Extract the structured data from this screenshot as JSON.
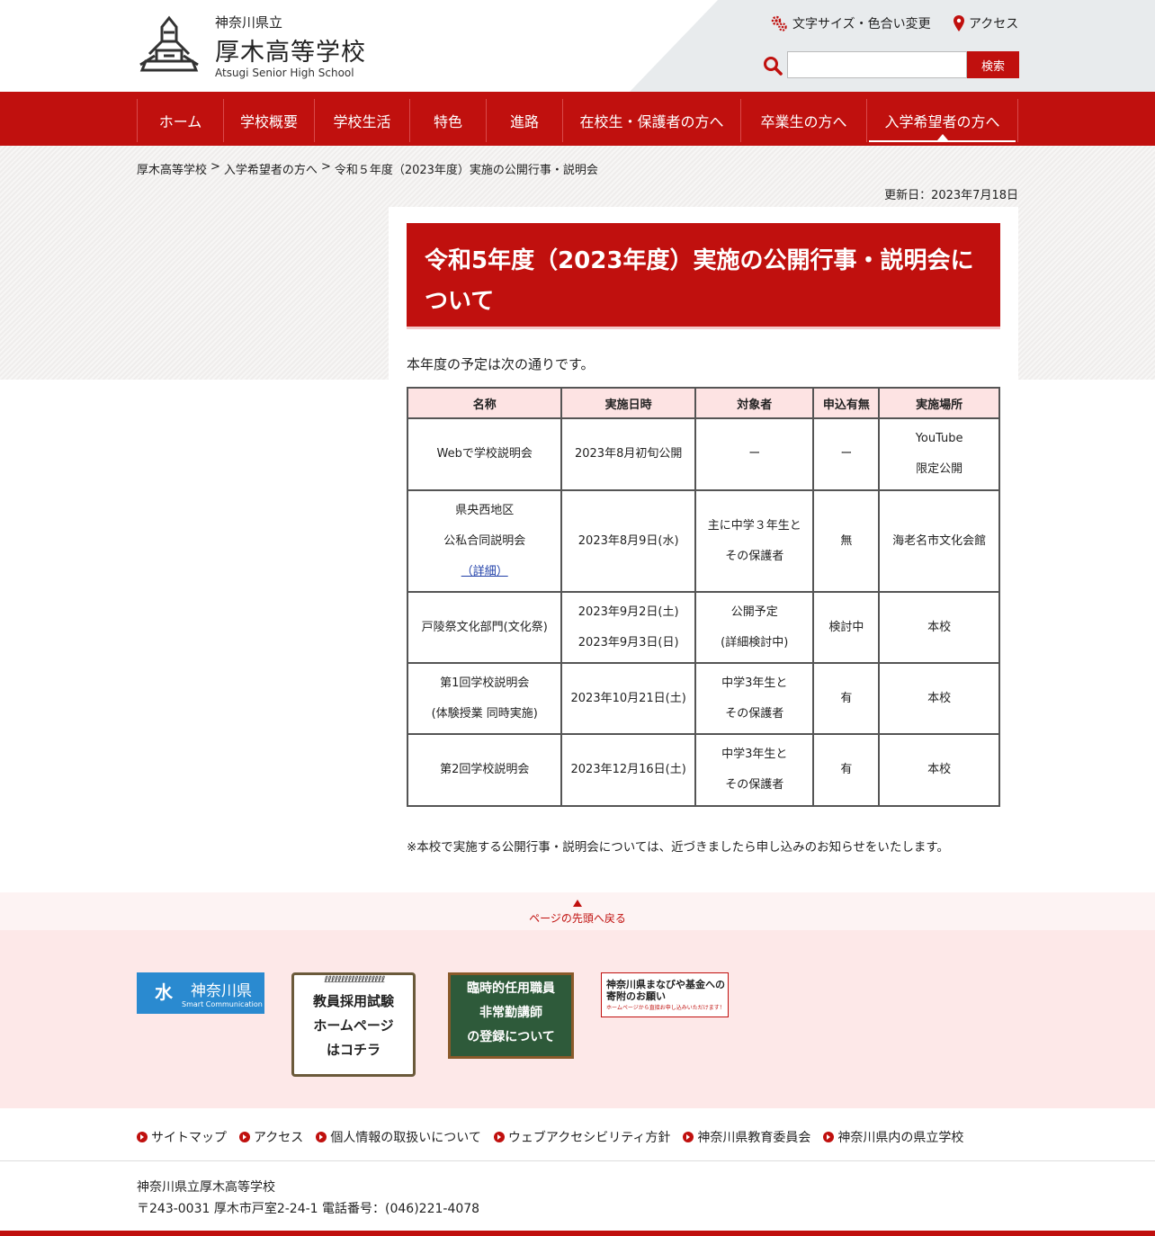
{
  "site": {
    "prefecture": "神奈川県立",
    "school_name": "厚木高等学校",
    "school_name_en": "Atsugi Senior High School",
    "brand_color": "#c0100e"
  },
  "utility": {
    "font_color_label": "文字サイズ・色合い変更",
    "access_label": "アクセス",
    "search_placeholder": "",
    "search_button": "検索"
  },
  "nav": {
    "items": [
      {
        "label": "ホーム"
      },
      {
        "label": "学校概要"
      },
      {
        "label": "学校生活"
      },
      {
        "label": "特色"
      },
      {
        "label": "進路"
      },
      {
        "label": "在校生・保護者の方へ"
      },
      {
        "label": "卒業生の方へ"
      },
      {
        "label": "入学希望者の方へ"
      }
    ]
  },
  "breadcrumb": {
    "items": [
      "厚木高等学校",
      "入学希望者の方へ",
      "令和５年度（2023年度）実施の公開行事・説明会"
    ],
    "separator": ">"
  },
  "updated": "更新日：2023年7月18日",
  "main": {
    "title": "令和5年度（2023年度）実施の公開行事・説明会について",
    "intro": "本年度の予定は次の通りです。",
    "table": {
      "headers": [
        "名称",
        "実施日時",
        "対象者",
        "申込有無",
        "実施場所"
      ],
      "rows": [
        {
          "name1": "Webで学校説明会",
          "name2": "",
          "name_link": "",
          "date1": "2023年8月初旬公開",
          "date2": "",
          "target1": "ー",
          "target2": "",
          "apply": "ー",
          "place1": "YouTube",
          "place2": "限定公開"
        },
        {
          "name1": "県央西地区",
          "name2": "公私合同説明会",
          "name_link": "（詳細）",
          "date1": "2023年8月9日(水)",
          "date2": "",
          "target1": "主に中学３年生と",
          "target2": "その保護者",
          "apply": "無",
          "place1": "海老名市文化会館",
          "place2": ""
        },
        {
          "name1": "戸陵祭文化部門(文化祭)",
          "name2": "",
          "name_link": "",
          "date1": "2023年9月2日(土)",
          "date2": "2023年9月3日(日)",
          "target1": "公開予定",
          "target2": "(詳細検討中)",
          "apply": "検討中",
          "place1": "本校",
          "place2": ""
        },
        {
          "name1": "第1回学校説明会",
          "name2": "(体験授業 同時実施)",
          "name_link": "",
          "date1": "2023年10月21日(土)",
          "date2": "",
          "target1": "中学3年生と",
          "target2": "その保護者",
          "apply": "有",
          "place1": "本校",
          "place2": ""
        },
        {
          "name1": "第2回学校説明会",
          "name2": "",
          "name_link": "",
          "date1": "2023年12月16日(土)",
          "date2": "",
          "target1": "中学3年生と",
          "target2": "その保護者",
          "apply": "有",
          "place1": "本校",
          "place2": ""
        }
      ]
    },
    "note": "※本校で実施する公開行事・説明会については、近づきましたら申し込みのお知らせをいたします。"
  },
  "pagetop": "ページの先頭へ戻る",
  "banners": {
    "kanagawa_jp": "神奈川県",
    "kanagawa_en": "Smart Communication",
    "teacher_line1": "教員採用試験",
    "teacher_line2": "ホームページ",
    "teacher_line3": "はコチラ",
    "temp_line1": "臨時的任用職員",
    "temp_line2": "非常勤講師",
    "temp_line3": "の登録について",
    "fund_line1": "神奈川県まなびや基金への",
    "fund_line2": "寄附のお願い",
    "fund_line3": "ホームページから直接お申し込みいただけます！"
  },
  "footer": {
    "links": [
      "サイトマップ",
      "アクセス",
      "個人情報の取扱いについて",
      "ウェブアクセシビリティ方針",
      "神奈川県教育委員会",
      "神奈川県内の県立学校"
    ],
    "name": "神奈川県立厚木高等学校",
    "address": "〒243-0031 厚木市戸室2-24-1 電話番号：(046)221-4078"
  }
}
